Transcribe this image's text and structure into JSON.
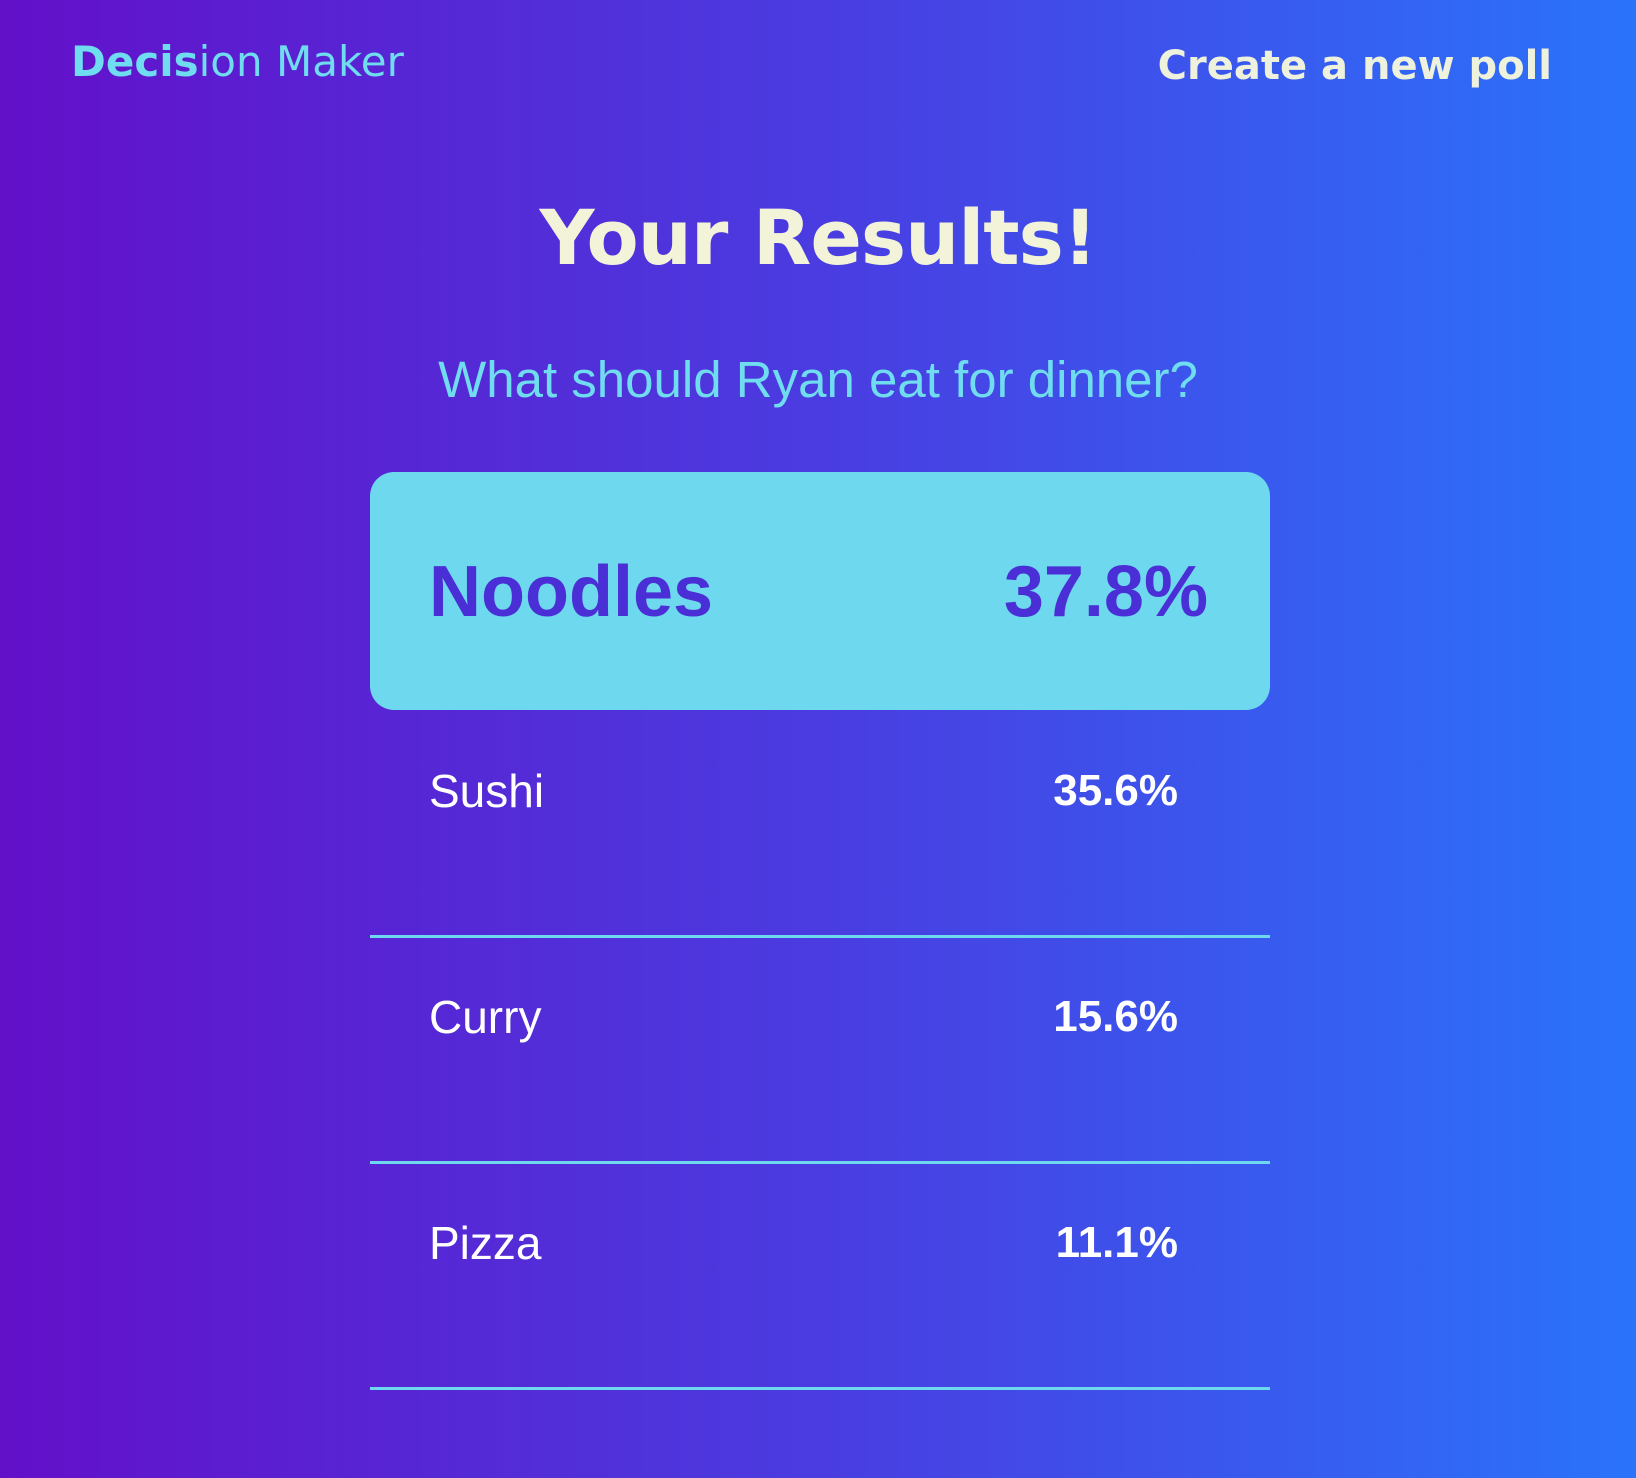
{
  "header": {
    "brand_bold": "Decis",
    "brand_light": "ion Maker",
    "new_poll_label": "Create a new poll"
  },
  "page": {
    "title": "Your Results!",
    "question": "What should Ryan eat for dinner?"
  },
  "results": [
    {
      "option": "Noodles",
      "percent": "37.8%"
    },
    {
      "option": "Sushi",
      "percent": "35.6%"
    },
    {
      "option": "Curry",
      "percent": "15.6%"
    },
    {
      "option": "Pizza",
      "percent": "11.1%"
    }
  ],
  "colors": {
    "gradient_start": "#6310c9",
    "gradient_end": "#2a73fb",
    "accent": "#6ed8ee",
    "winner_text": "#4b2fd6",
    "title_text": "#f2f3d8"
  }
}
